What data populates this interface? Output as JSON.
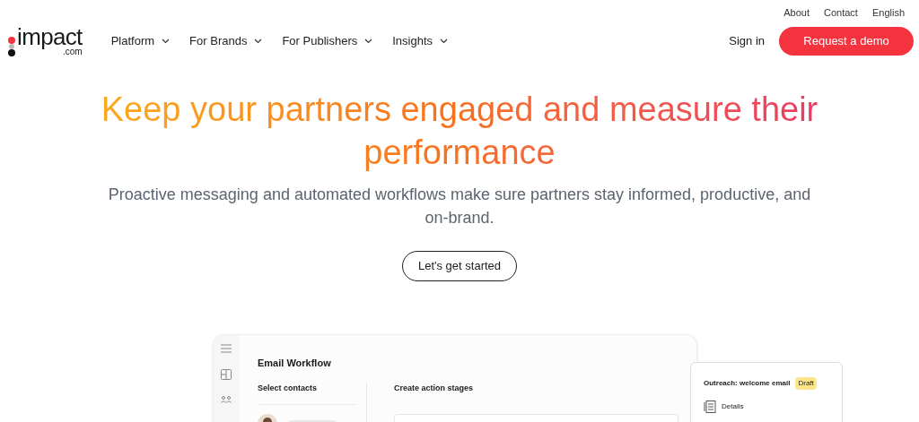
{
  "top_links": [
    "About",
    "Contact",
    "English"
  ],
  "logo": {
    "name": "impact",
    "suffix": ".com"
  },
  "nav": [
    {
      "label": "Platform"
    },
    {
      "label": "For Brands"
    },
    {
      "label": "For Publishers"
    },
    {
      "label": "Insights"
    }
  ],
  "sign_in": "Sign in",
  "cta": "Request a demo",
  "hero": {
    "title": "Keep your partners engaged and measure their performance",
    "subtitle": "Proactive messaging and automated workflows make sure partners stay informed, productive, and on-brand.",
    "button": "Let's get started"
  },
  "mockup": {
    "title": "Email Workflow",
    "left_heading": "Select contacts",
    "right_heading": "Create action stages",
    "card": {
      "title": "Outreach: welcome email",
      "badge": "Draft",
      "item": "Details"
    }
  }
}
